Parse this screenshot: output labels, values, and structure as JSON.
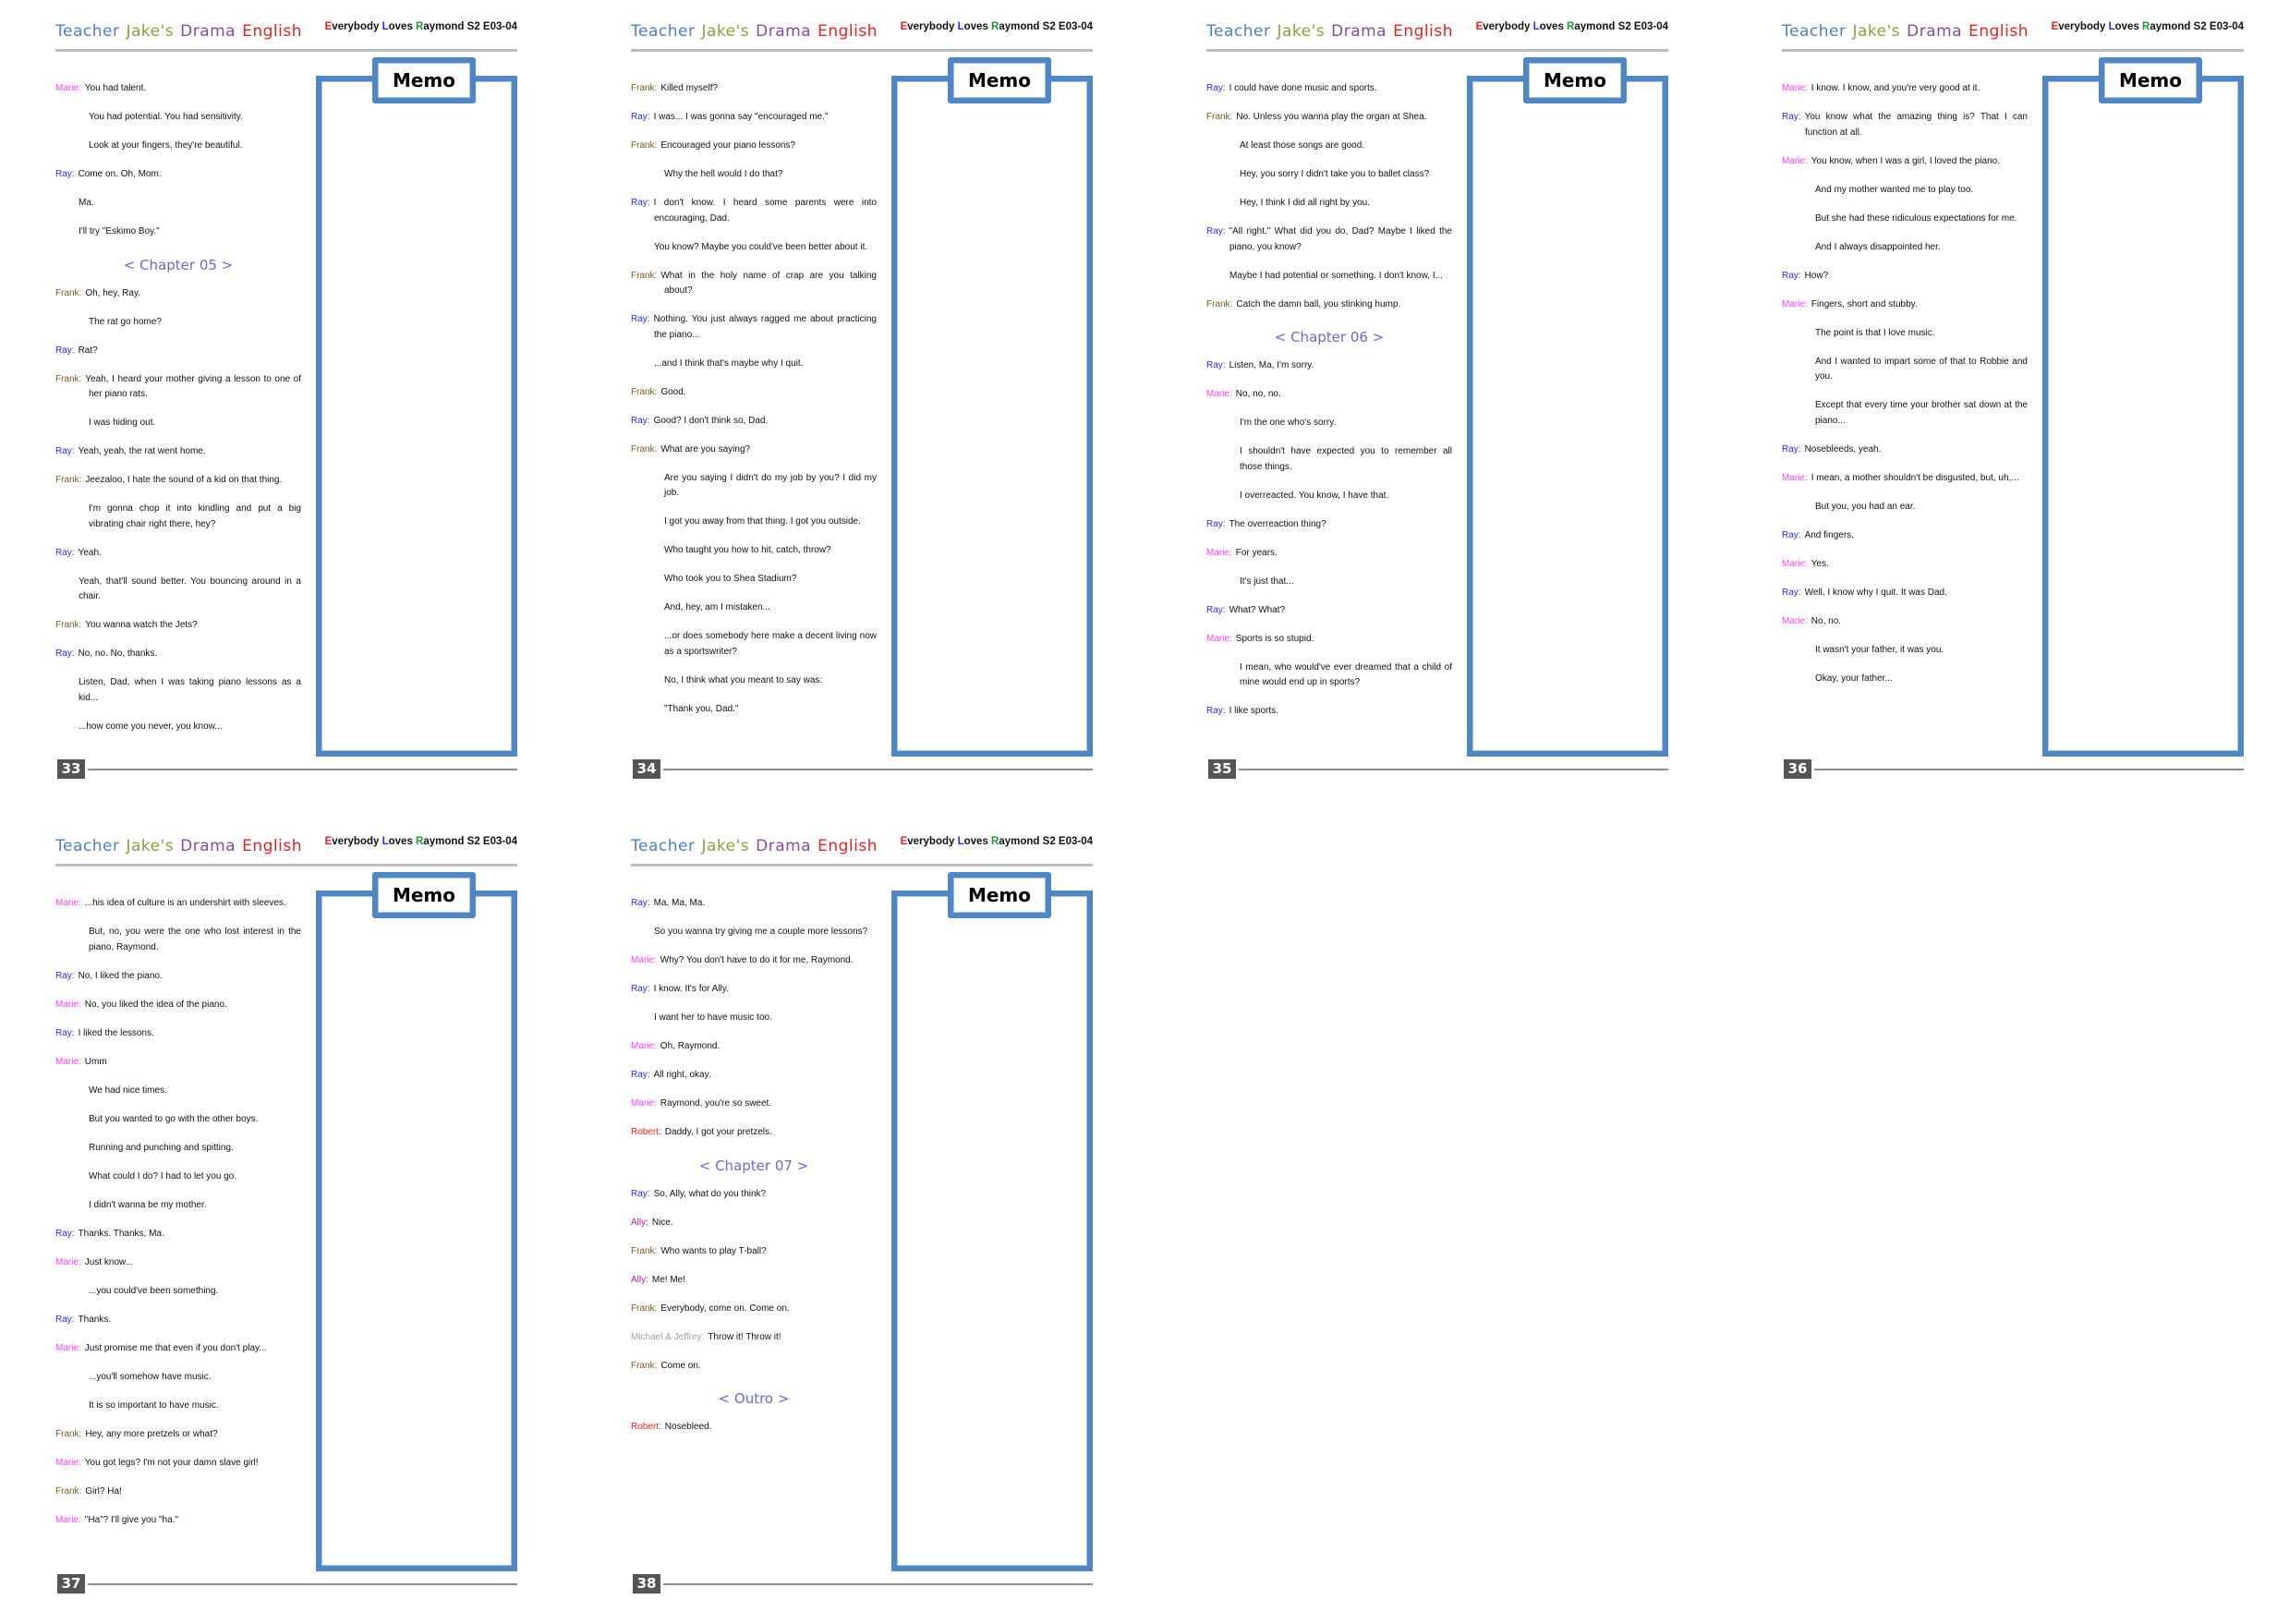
{
  "header": {
    "brand": [
      {
        "text": "Teacher",
        "color": "#4a80c8"
      },
      {
        "text": "Jake's",
        "color": "#8aa040"
      },
      {
        "text": "Drama",
        "color": "#8a4a9a"
      },
      {
        "text": "English",
        "color": "#e82020"
      }
    ],
    "episode": [
      {
        "text": "E",
        "color": "#e82020"
      },
      {
        "text": "verybody ",
        "color": "#111111"
      },
      {
        "text": "L",
        "color": "#2a2aff"
      },
      {
        "text": "oves ",
        "color": "#111111"
      },
      {
        "text": "R",
        "color": "#1a9a30"
      },
      {
        "text": "aymond S2 E03-04",
        "color": "#111111"
      }
    ]
  },
  "memo_label": "Memo",
  "speaker_colors": {
    "Marie": "#ff40ff",
    "Ray": "#2a2aff",
    "Frank": "#7a5a20",
    "Robert": "#ff2020",
    "Ally": "#a020a0",
    "Michael & Jeffrey": "#a0a0a0"
  },
  "pages": [
    {
      "number": "33",
      "lines": [
        {
          "speaker": "Marie",
          "text": "You had talent."
        },
        {
          "cont": true,
          "indent": "Marie",
          "text": "You had potential. You had sensitivity."
        },
        {
          "cont": true,
          "indent": "Marie",
          "text": "Look at your fingers, they're beautiful."
        },
        {
          "speaker": "Ray",
          "text": "Come on. Oh, Mom."
        },
        {
          "cont": true,
          "indent": "Ray",
          "text": "Ma."
        },
        {
          "cont": true,
          "indent": "Ray",
          "text": "I'll try \"Eskimo Boy.\""
        },
        {
          "chapter": "< Chapter 05 >"
        },
        {
          "speaker": "Frank",
          "text": "Oh, hey, Ray."
        },
        {
          "cont": true,
          "indent": "Frank",
          "text": "The rat go home?"
        },
        {
          "speaker": "Ray",
          "text": "Rat?"
        },
        {
          "speaker": "Frank",
          "text": "Yeah, I heard your mother giving a lesson to one of her piano rats."
        },
        {
          "cont": true,
          "indent": "Frank",
          "text": "I was hiding out."
        },
        {
          "speaker": "Ray",
          "text": "Yeah, yeah, the rat went home."
        },
        {
          "speaker": "Frank",
          "text": "Jeezaloo, I hate the sound of a kid on that thing."
        },
        {
          "cont": true,
          "indent": "Frank",
          "text": "I'm gonna chop it into kindling and put a big vibrating chair right there, hey?"
        },
        {
          "speaker": "Ray",
          "text": "Yeah."
        },
        {
          "cont": true,
          "indent": "Ray",
          "text": "Yeah, that'll sound better. You bouncing around in a chair."
        },
        {
          "speaker": "Frank",
          "text": "You wanna watch the Jets?"
        },
        {
          "speaker": "Ray",
          "text": "No, no. No, thanks."
        },
        {
          "cont": true,
          "indent": "Ray",
          "text": "Listen, Dad, when I was taking piano lessons as a kid..."
        },
        {
          "cont": true,
          "indent": "Ray",
          "text": "...how come you never, you know..."
        }
      ]
    },
    {
      "number": "34",
      "lines": [
        {
          "speaker": "Frank",
          "text": "Killed myself?"
        },
        {
          "speaker": "Ray",
          "text": "I was... I was gonna say \"encouraged me.\""
        },
        {
          "speaker": "Frank",
          "text": "Encouraged your piano lessons?"
        },
        {
          "cont": true,
          "indent": "Frank",
          "text": "Why the hell would I do that?"
        },
        {
          "speaker": "Ray",
          "text": "I don't know. I heard some parents were into encouraging, Dad."
        },
        {
          "cont": true,
          "indent": "Ray",
          "text": "You know? Maybe you could've been better about it."
        },
        {
          "speaker": "Frank",
          "text": "What in the holy name of crap are you talking about?"
        },
        {
          "speaker": "Ray",
          "text": "Nothing. You just always ragged me about practicing the piano..."
        },
        {
          "cont": true,
          "indent": "Ray",
          "text": "...and I think that's maybe why I quit."
        },
        {
          "speaker": "Frank",
          "text": "Good."
        },
        {
          "speaker": "Ray",
          "text": "Good? I don't think so, Dad."
        },
        {
          "speaker": "Frank",
          "text": "What are you saying?"
        },
        {
          "cont": true,
          "indent": "Frank",
          "text": "Are you saying I didn't do my job by you? I did my job."
        },
        {
          "cont": true,
          "indent": "Frank",
          "text": "I got you away from that thing. I got you outside."
        },
        {
          "cont": true,
          "indent": "Frank",
          "text": "Who taught you how to hit, catch, throw?"
        },
        {
          "cont": true,
          "indent": "Frank",
          "text": "Who took you to Shea Stadium?"
        },
        {
          "cont": true,
          "indent": "Frank",
          "text": "And, hey, am I mistaken..."
        },
        {
          "cont": true,
          "indent": "Frank",
          "text": "...or does somebody here make a decent living now as a sportswriter?"
        },
        {
          "cont": true,
          "indent": "Frank",
          "text": "No, I think what you meant to say was:"
        },
        {
          "cont": true,
          "indent": "Frank",
          "text": "\"Thank you, Dad.\""
        }
      ]
    },
    {
      "number": "35",
      "lines": [
        {
          "speaker": "Ray",
          "text": "I could have done music and sports."
        },
        {
          "speaker": "Frank",
          "text": "No. Unless you wanna play the organ at Shea."
        },
        {
          "cont": true,
          "indent": "Frank",
          "text": "At least those songs are good."
        },
        {
          "cont": true,
          "indent": "Frank",
          "text": "Hey, you sorry I didn't take you to ballet class?"
        },
        {
          "cont": true,
          "indent": "Frank",
          "text": "Hey, I think I did all right by you."
        },
        {
          "speaker": "Ray",
          "text": "\"All right.\" What did you do, Dad? Maybe I liked the piano, you know?"
        },
        {
          "cont": true,
          "indent": "Ray",
          "text": "Maybe I had potential or something. I don't know, I..."
        },
        {
          "speaker": "Frank",
          "text": "Catch the damn ball, you stinking hump."
        },
        {
          "chapter": "< Chapter 06 >"
        },
        {
          "speaker": "Ray",
          "text": "Listen, Ma, I'm sorry."
        },
        {
          "speaker": "Marie",
          "text": "No, no, no."
        },
        {
          "cont": true,
          "indent": "Marie",
          "text": "I'm the one who's sorry."
        },
        {
          "cont": true,
          "indent": "Marie",
          "text": "I shouldn't have expected you to remember all those things."
        },
        {
          "cont": true,
          "indent": "Marie",
          "text": "I overreacted. You know, I have that."
        },
        {
          "speaker": "Ray",
          "text": "The overreaction thing?"
        },
        {
          "speaker": "Marie",
          "text": "For years."
        },
        {
          "cont": true,
          "indent": "Marie",
          "text": "It's just that..."
        },
        {
          "speaker": "Ray",
          "text": "What? What?"
        },
        {
          "speaker": "Marie",
          "text": "Sports is so stupid."
        },
        {
          "cont": true,
          "indent": "Marie",
          "text": "I mean, who would've ever dreamed that a child of mine would end up in sports?"
        },
        {
          "speaker": "Ray",
          "text": "I like sports."
        }
      ]
    },
    {
      "number": "36",
      "lines": [
        {
          "speaker": "Marie",
          "text": "I know. I know, and you're very good at it."
        },
        {
          "speaker": "Ray",
          "text": "You know what the amazing thing is? That I can function at all."
        },
        {
          "speaker": "Marie",
          "text": "You know, when I was a girl, I loved the piano."
        },
        {
          "cont": true,
          "indent": "Marie",
          "text": "And my mother wanted me to play too."
        },
        {
          "cont": true,
          "indent": "Marie",
          "text": "But she had these ridiculous expectations for me."
        },
        {
          "cont": true,
          "indent": "Marie",
          "text": "And I always disappointed her."
        },
        {
          "speaker": "Ray",
          "text": "How?"
        },
        {
          "speaker": "Marie",
          "text": "Fingers, short and stubby."
        },
        {
          "cont": true,
          "indent": "Marie",
          "text": "The point is that I love music."
        },
        {
          "cont": true,
          "indent": "Marie",
          "text": "And I wanted to impart some of that to Robbie and you."
        },
        {
          "cont": true,
          "indent": "Marie",
          "text": "Except that every time your brother sat down at the piano..."
        },
        {
          "speaker": "Ray",
          "text": "Nosebleeds, yeah."
        },
        {
          "speaker": "Marie",
          "text": "I mean, a mother shouldn't be disgusted, but, uh,..."
        },
        {
          "cont": true,
          "indent": "Marie",
          "text": "But you, you had an ear."
        },
        {
          "speaker": "Ray",
          "text": "And fingers."
        },
        {
          "speaker": "Marie",
          "text": "Yes."
        },
        {
          "speaker": "Ray",
          "text": "Well, I know why I quit. It was Dad."
        },
        {
          "speaker": "Marie",
          "text": "No, no."
        },
        {
          "cont": true,
          "indent": "Marie",
          "text": "It wasn't your father, it was you."
        },
        {
          "cont": true,
          "indent": "Marie",
          "text": "Okay, your father..."
        }
      ]
    },
    {
      "number": "37",
      "lines": [
        {
          "speaker": "Marie",
          "text": "...his idea of culture is an undershirt with sleeves."
        },
        {
          "cont": true,
          "indent": "Marie",
          "text": "But, no, you were the one who lost interest in the piano, Raymond."
        },
        {
          "speaker": "Ray",
          "text": "No, I liked the piano."
        },
        {
          "speaker": "Marie",
          "text": "No, you liked the idea of the piano."
        },
        {
          "speaker": "Ray",
          "text": "I liked the lessons."
        },
        {
          "speaker": "Marie",
          "text": "Umm"
        },
        {
          "cont": true,
          "indent": "Marie",
          "text": "We had nice times."
        },
        {
          "cont": true,
          "indent": "Marie",
          "text": "But you wanted to go with the other boys."
        },
        {
          "cont": true,
          "indent": "Marie",
          "text": "Running and punching and spitting."
        },
        {
          "cont": true,
          "indent": "Marie",
          "text": "What could I do? I had to let you go."
        },
        {
          "cont": true,
          "indent": "Marie",
          "text": "I didn't wanna be my mother."
        },
        {
          "speaker": "Ray",
          "text": "Thanks. Thanks, Ma."
        },
        {
          "speaker": "Marie",
          "text": "Just know..."
        },
        {
          "cont": true,
          "indent": "Marie",
          "text": "...you could've been something."
        },
        {
          "speaker": "Ray",
          "text": "Thanks."
        },
        {
          "speaker": "Marie",
          "text": "Just promise me that even if you don't play..."
        },
        {
          "cont": true,
          "indent": "Marie",
          "text": "...you'll somehow have music."
        },
        {
          "cont": true,
          "indent": "Marie",
          "text": "It is so important to have music."
        },
        {
          "speaker": "Frank",
          "text": "Hey, any more pretzels or what?"
        },
        {
          "speaker": "Marie",
          "text": "You got legs? I'm not your damn slave girl!"
        },
        {
          "speaker": "Frank",
          "text": "Girl? Ha!"
        },
        {
          "speaker": "Marie",
          "text": "\"Ha\"? I'll give you \"ha.\""
        }
      ]
    },
    {
      "number": "38",
      "lines": [
        {
          "speaker": "Ray",
          "text": "Ma, Ma, Ma."
        },
        {
          "cont": true,
          "indent": "Ray",
          "text": "So you wanna try giving me a couple more lessons?"
        },
        {
          "speaker": "Marie",
          "text": "Why? You don't have to do it for me, Raymond."
        },
        {
          "speaker": "Ray",
          "text": "I know. It's for Ally."
        },
        {
          "cont": true,
          "indent": "Ray",
          "text": "I want her to have music too."
        },
        {
          "speaker": "Marie",
          "text": "Oh, Raymond."
        },
        {
          "speaker": "Ray",
          "text": "All right, okay."
        },
        {
          "speaker": "Marie",
          "text": "Raymond, you're so sweet."
        },
        {
          "speaker": "Robert",
          "text": "Daddy, I got your pretzels."
        },
        {
          "chapter": "< Chapter 07 >"
        },
        {
          "speaker": "Ray",
          "text": "So, Ally, what do you think?"
        },
        {
          "speaker": "Ally",
          "text": "Nice."
        },
        {
          "speaker": "Frank",
          "text": "Who wants to play T-ball?"
        },
        {
          "speaker": "Ally",
          "text": "Me! Me!"
        },
        {
          "speaker": "Frank",
          "text": "Everybody, come on. Come on."
        },
        {
          "speaker": "Michael & Jeffrey",
          "text": "Throw it! Throw it!"
        },
        {
          "speaker": "Frank",
          "text": "Come on."
        },
        {
          "chapter": "< Outro >"
        },
        {
          "speaker": "Robert",
          "text": "Nosebleed."
        }
      ]
    }
  ]
}
